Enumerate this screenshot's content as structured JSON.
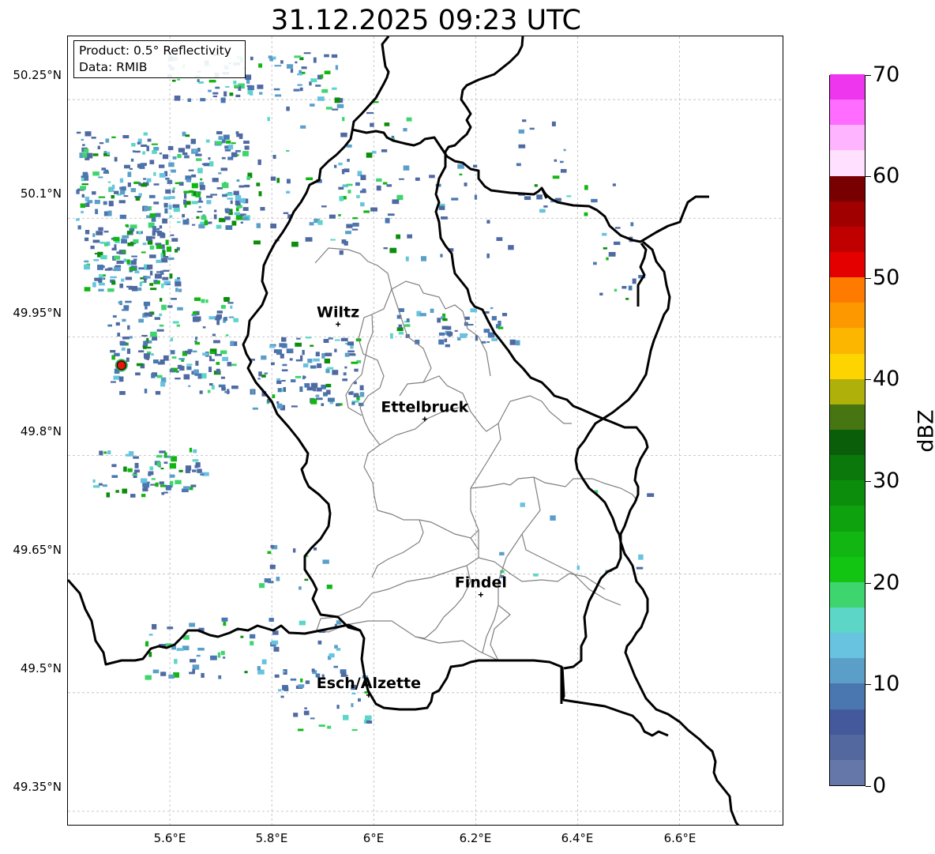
{
  "title": "31.12.2025 09:23 UTC",
  "info": {
    "product": "Product: 0.5° Reflectivity",
    "data": "Data: RMIB"
  },
  "lat_labels": [
    "50.25°N",
    "50.1°N",
    "49.95°N",
    "49.8°N",
    "49.65°N",
    "49.5°N",
    "49.35°N"
  ],
  "lon_labels": [
    "5.6°E",
    "5.8°E",
    "6°E",
    "6.2°E",
    "6.4°E",
    "6.6°E"
  ],
  "cities": [
    {
      "name": "Wiltz",
      "lon": 5.93,
      "lat": 49.966
    },
    {
      "name": "Ettelbruck",
      "lon": 6.1,
      "lat": 49.846
    },
    {
      "name": "Findel",
      "lon": 6.21,
      "lat": 49.624
    },
    {
      "name": "Esch/Alzette",
      "lon": 5.99,
      "lat": 49.497
    }
  ],
  "radar_site": {
    "lon": 5.505,
    "lat": 49.914,
    "color": "#e3150f"
  },
  "colorbar": {
    "label": "dBZ",
    "ticks": [
      "0",
      "10",
      "20",
      "30",
      "40",
      "50",
      "60",
      "70"
    ],
    "min": 0,
    "max": 70,
    "step": 2.5,
    "colors": [
      "#6577a8",
      "#53689f",
      "#43599c",
      "#4a77b0",
      "#5b9fc9",
      "#67c3df",
      "#5bd6c7",
      "#3fd56e",
      "#12c512",
      "#12b612",
      "#0fa20f",
      "#0c8d0c",
      "#0b780b",
      "#0a5e0a",
      "#467512",
      "#b0b00a",
      "#fdd400",
      "#fdb600",
      "#fd9800",
      "#fe7b00",
      "#e50000",
      "#c00000",
      "#a00000",
      "#780000",
      "#ffe0ff",
      "#ffb4ff",
      "#ff6cff",
      "#ed36ed"
    ]
  }
}
